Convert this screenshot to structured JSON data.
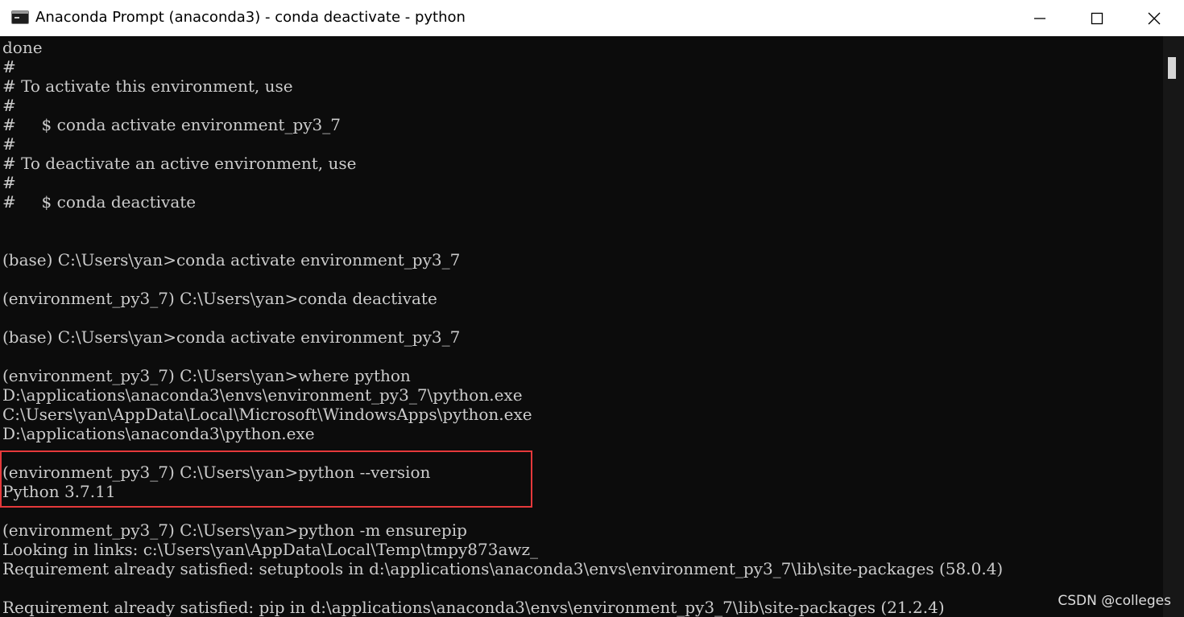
{
  "window": {
    "title": "Anaconda Prompt (anaconda3) - conda  deactivate - python",
    "icon": "terminal-icon",
    "controls": {
      "minimize_icon": "minimize-icon",
      "maximize_icon": "maximize-icon",
      "close_icon": "close-icon"
    }
  },
  "terminal": {
    "lines": [
      "done",
      "#",
      "# To activate this environment, use",
      "#",
      "#     $ conda activate environment_py3_7",
      "#",
      "# To deactivate an active environment, use",
      "#",
      "#     $ conda deactivate",
      "",
      "",
      "(base) C:\\Users\\yan>conda activate environment_py3_7",
      "",
      "(environment_py3_7) C:\\Users\\yan>conda deactivate",
      "",
      "(base) C:\\Users\\yan>conda activate environment_py3_7",
      "",
      "(environment_py3_7) C:\\Users\\yan>where python",
      "D:\\applications\\anaconda3\\envs\\environment_py3_7\\python.exe",
      "C:\\Users\\yan\\AppData\\Local\\Microsoft\\WindowsApps\\python.exe",
      "D:\\applications\\anaconda3\\python.exe",
      "",
      "(environment_py3_7) C:\\Users\\yan>python --version",
      "Python 3.7.11",
      "",
      "(environment_py3_7) C:\\Users\\yan>python -m ensurepip",
      "Looking in links: c:\\Users\\yan\\AppData\\Local\\Temp\\tmpy873awz_",
      "Requirement already satisfied: setuptools in d:\\applications\\anaconda3\\envs\\environment_py3_7\\lib\\site-packages (58.0.4)",
      "",
      "Requirement already satisfied: pip in d:\\applications\\anaconda3\\envs\\environment_py3_7\\lib\\site-packages (21.2.4)"
    ],
    "highlight_color": "#e5393b"
  },
  "watermark": "CSDN @colleges",
  "colors": {
    "terminal_bg": "#0c0c0c",
    "terminal_text": "#cccccc",
    "titlebar_bg": "#ffffff"
  }
}
